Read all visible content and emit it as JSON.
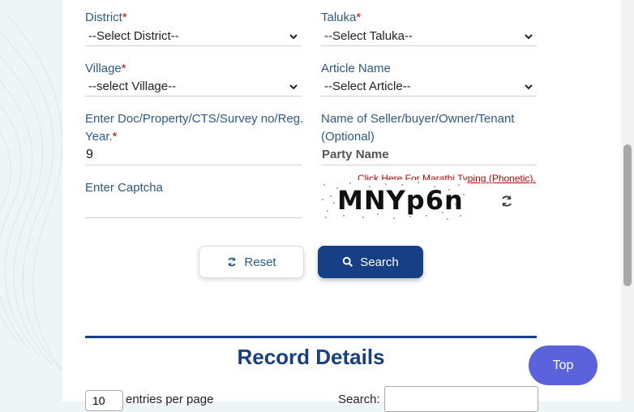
{
  "form": {
    "district": {
      "label": "District",
      "required": "*",
      "value": "--Select District--"
    },
    "taluka": {
      "label": "Taluka",
      "required": "*",
      "value": "--Select Taluka--"
    },
    "village": {
      "label": "Village",
      "required": "*",
      "value": "--select Village--"
    },
    "article": {
      "label": "Article Name",
      "value": "--Select Article--"
    },
    "doc_no": {
      "label_line1": "Enter Doc/Property/CTS/Survey no/Reg.",
      "label_line2": "Year.",
      "required": "*",
      "value": "9"
    },
    "party": {
      "label_line1": "Name of Seller/buyer/Owner/Tenant",
      "label_line2": "(Optional)",
      "placeholder": "Party Name"
    },
    "captcha": {
      "label": "Enter Captcha",
      "value": "",
      "image_text": "MNYp6n"
    },
    "marathi_link": "Click Here For Marathi Typing (Phonetic)."
  },
  "buttons": {
    "reset": {
      "label": "Reset",
      "icon": "refresh-icon"
    },
    "search": {
      "label": "Search",
      "icon": "search-icon"
    }
  },
  "records": {
    "title": "Record Details",
    "entries_value": "10",
    "entries_text": "entries per page",
    "search_label": "Search:"
  },
  "top_button": "Top",
  "colors": {
    "primary": "#163f85",
    "label": "#2b5a8a",
    "required": "#d10000",
    "top": "#5b63dc"
  }
}
